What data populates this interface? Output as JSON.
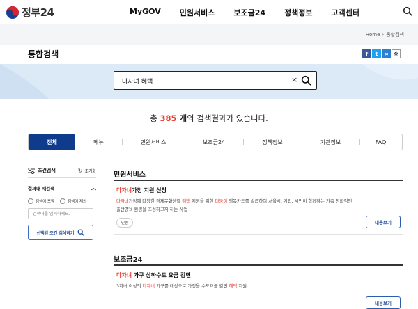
{
  "header": {
    "logo_text": "정부24",
    "nav": [
      "MyGOV",
      "민원서비스",
      "보조금24",
      "정책정보",
      "고객센터"
    ]
  },
  "breadcrumb": [
    "Home",
    "통합검색"
  ],
  "page": {
    "title": "통합검색"
  },
  "search": {
    "value": "다자녀 혜택",
    "clear": "×"
  },
  "result_summary": {
    "prefix": "총 ",
    "count": "385",
    "unit": " 개",
    "suffix": "의 검색결과가 있습니다."
  },
  "tabs": [
    "전체",
    "메뉴",
    "민원서비스",
    "보조금24",
    "정책정보",
    "기관정보",
    "FAQ"
  ],
  "filter": {
    "title": "조건검색",
    "reset": "초기화",
    "refine_title": "결과내 재검색",
    "opt_include": "검색어 포함",
    "opt_exclude": "검색어 제외",
    "input_placeholder": "검색어를 입력하세요.",
    "apply": "선택된 조건 검색하기"
  },
  "sections": {
    "civil": {
      "title": "민원서비스",
      "item": {
        "title_hl": "다자녀",
        "title_rest": "가정 지원 신청",
        "desc": [
          {
            "t": "다자녀",
            "h": true
          },
          {
            "t": "가정에 다양한 경제문화생활 ",
            "h": false
          },
          {
            "t": "혜택",
            "h": true
          },
          {
            "t": " 지원을 위한 ",
            "h": false
          },
          {
            "t": "다둥이",
            "h": true
          },
          {
            "t": " 행복카드를 발급하여 서울시, 기업, 시민이 함께하는 가족 친화적인 출산양육 환경을 조성하고자 하는 사업",
            "h": false
          }
        ],
        "tag": "민원",
        "button": "내용보기"
      }
    },
    "subsidy": {
      "title": "보조금24",
      "item": {
        "title_hl": "다자녀",
        "title_rest": " 가구 상하수도 요금 감면",
        "desc": [
          {
            "t": "3자녀 이상의 ",
            "h": false
          },
          {
            "t": "다자녀",
            "h": true
          },
          {
            "t": " 가구를 대상으로 가정용 수도요금 감면 ",
            "h": false
          },
          {
            "t": "혜택",
            "h": true
          },
          {
            "t": " 지원",
            "h": false
          }
        ],
        "button": "내용보기"
      }
    }
  },
  "colors": {
    "brand_blue": "#0f3b8c",
    "highlight": "#e8382b",
    "hero_bg": "#dceaf7"
  }
}
